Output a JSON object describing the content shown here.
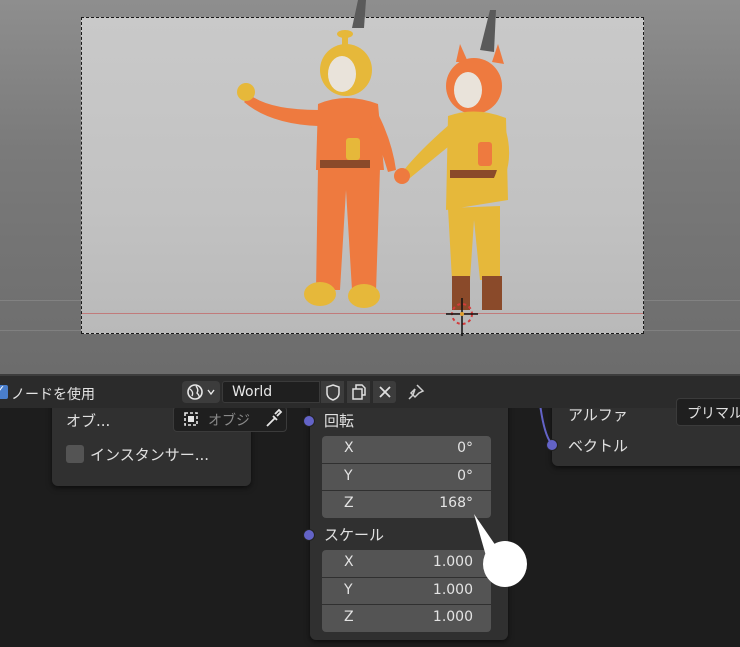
{
  "header": {
    "use_nodes_label": "ノードを使用",
    "use_nodes_checked": true,
    "world_name": "World",
    "icons": [
      "world-icon",
      "chevron-down-icon",
      "fake-user-shield-icon",
      "duplicate-icon",
      "close-icon",
      "pin-icon"
    ]
  },
  "object_node": {
    "object_label": "オブ...",
    "object_placeholder": "オブジ",
    "instancer_label": "インスタンサー...",
    "icons": [
      "object-square-icon",
      "eyedropper-icon"
    ]
  },
  "transform_node": {
    "rotation_label": "回転",
    "rotation": [
      {
        "axis": "X",
        "value": "0°"
      },
      {
        "axis": "Y",
        "value": "0°"
      },
      {
        "axis": "Z",
        "value": "168°"
      }
    ],
    "scale_label": "スケール",
    "scale": [
      {
        "axis": "X",
        "value": "1.000"
      },
      {
        "axis": "Y",
        "value": "1.000"
      },
      {
        "axis": "Z",
        "value": "1.000"
      }
    ]
  },
  "output_node": {
    "alpha_label": "アルファ",
    "alpha_value": "プリマル",
    "vector_label": "ベクトル"
  },
  "colors": {
    "socket_vector": "#6363c7",
    "checkbox_accent": "#4a7ecb",
    "character_orange": "#e8763a",
    "character_yellow": "#e8b93a"
  }
}
